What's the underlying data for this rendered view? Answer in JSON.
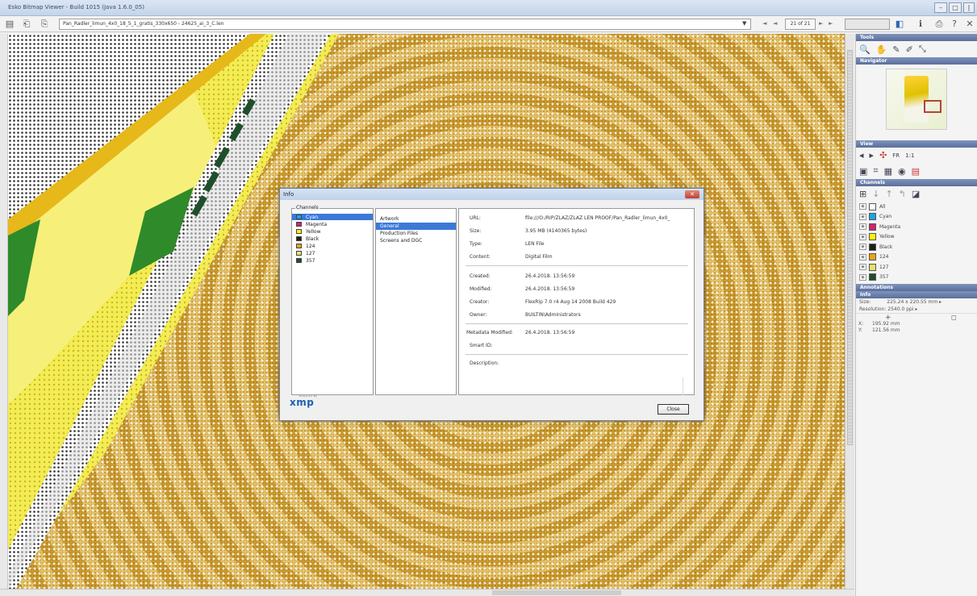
{
  "window": {
    "title": "Esko Bitmap Viewer - Build 1015 (Java 1.6.0_05)"
  },
  "toolbar": {
    "file_name": "Pan_Radler_limun_4x0_18_5_1_gratis_330x650 - 24625_ai_3_C.len",
    "page": "21 of 21"
  },
  "panel": {
    "tools_title": "Tools",
    "navigator_title": "Navigator",
    "view_title": "View",
    "channels_title": "Channels",
    "annotations_title": "Annotations",
    "info_title": "Info",
    "channels": [
      {
        "name": "All",
        "color": "#ffffff"
      },
      {
        "name": "Cyan",
        "color": "#1aa6e3"
      },
      {
        "name": "Magenta",
        "color": "#d0256e"
      },
      {
        "name": "Yellow",
        "color": "#fff200"
      },
      {
        "name": "Black",
        "color": "#1e1e1e"
      },
      {
        "name": "124",
        "color": "#e8a415"
      },
      {
        "name": "127",
        "color": "#e4e36a"
      },
      {
        "name": "357",
        "color": "#1f4f2a"
      }
    ],
    "info": {
      "size_label": "Size:",
      "size_value": "225.24 x 220.55 mm",
      "resolution_label": "Resolution:",
      "resolution_value": "2540.0 ppi",
      "x_label": "X:",
      "x_value": "195.92 mm",
      "y_label": "Y:",
      "y_value": "121.56 mm"
    }
  },
  "dialog": {
    "title": "Info",
    "channels_legend": "Channels",
    "channels": [
      {
        "name": "Cyan",
        "color": "#1aa6e3",
        "selected": true
      },
      {
        "name": "Magenta",
        "color": "#d0256e"
      },
      {
        "name": "Yellow",
        "color": "#fff200"
      },
      {
        "name": "Black",
        "color": "#1e1e1e"
      },
      {
        "name": "124",
        "color": "#e8a415"
      },
      {
        "name": "127",
        "color": "#e4e36a"
      },
      {
        "name": "357",
        "color": "#1f4f2a"
      }
    ],
    "categories": [
      "Artwork",
      "General",
      "Production Files",
      "Screens and DGC"
    ],
    "selected_category": "General",
    "fields": {
      "url_label": "URL:",
      "url_value": "file:///O:/RIP/ZLAZ/ZLAZ LEN PROOF/Pan_Radler_limun_4x0_",
      "size_label": "Size:",
      "size_value": "3.95 MB (4140365 bytes)",
      "type_label": "Type:",
      "type_value": "LEN File",
      "content_label": "Content:",
      "content_value": "Digital Film",
      "created_label": "Created:",
      "created_value": "26.4.2018. 13:56:59",
      "modified_label": "Modified:",
      "modified_value": "26.4.2018. 13:56:59",
      "creator_label": "Creator:",
      "creator_value": "FlexRip 7.0 r4 Aug 14 2008 Build 429",
      "owner_label": "Owner:",
      "owner_value": "BUILTIN\\Administrators",
      "metadata_label": "Metadata Modified:",
      "metadata_value": "26.4.2018. 13:56:59",
      "smartid_label": "Smart ID:",
      "description_label": "Description:"
    },
    "powered_by": "Powered By",
    "xmp_logo": "xmp",
    "close_label": "Close"
  }
}
